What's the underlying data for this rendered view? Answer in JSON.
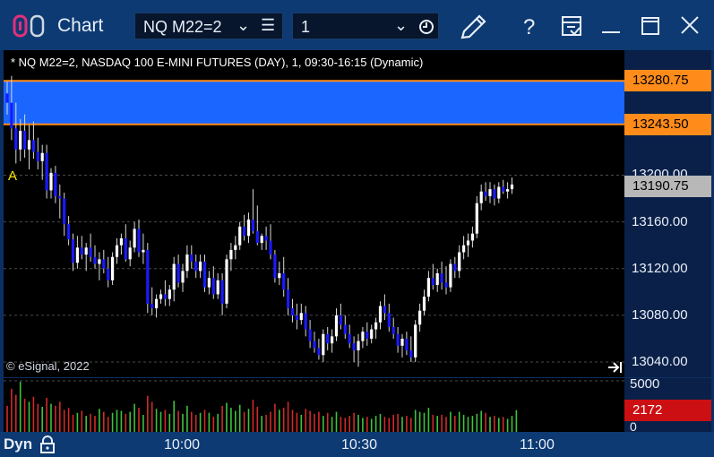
{
  "titlebar": {
    "app_title": "Chart",
    "symbol": "NQ M22=2",
    "interval": "1",
    "icons": [
      "link-icon",
      "chevron-down-icon",
      "menu-icon",
      "chevron-down-icon",
      "clock-icon",
      "pencil-icon",
      "help-icon",
      "save-layout-icon",
      "minimize-icon",
      "maximize-icon",
      "close-icon"
    ],
    "accent": "#0d3a72"
  },
  "chart": {
    "study_title": "* NQ M22=2, NASDAQ 100 E-MINI FUTURES (DAY), 1, 09:30-16:15 (Dynamic)",
    "copyright": "© eSignal, 2022",
    "annotation": "A",
    "price_ticks": [
      "13200.00",
      "13160.00",
      "13120.00",
      "13080.00",
      "13040.00"
    ],
    "price_labels": {
      "upper": "13280.75",
      "lower": "13243.50",
      "last": "13190.75"
    },
    "volume_ticks": [
      "5000",
      "0"
    ],
    "volume_last": "2172",
    "time_ticks": [
      "10:00",
      "10:30",
      "11:00"
    ],
    "bottom_label": "Dyn",
    "colors": {
      "up": "#ffffff",
      "down": "#1a1aff",
      "band": "#1a66ff",
      "level_line": "#ff8c1a",
      "vol_up": "#3ec23e",
      "vol_down": "#d12a2a"
    }
  },
  "chart_data": {
    "type": "candlestick",
    "ylim": [
      13027,
      13307
    ],
    "band": [
      13243.5,
      13280.75
    ],
    "price_ticks": [
      13200,
      13160,
      13120,
      13080,
      13040
    ],
    "last_price": 13190.75,
    "ohlc": [
      [
        13270,
        13280,
        13252,
        13262
      ],
      [
        13262,
        13285,
        13230,
        13240
      ],
      [
        13240,
        13262,
        13210,
        13222
      ],
      [
        13222,
        13248,
        13212,
        13238
      ],
      [
        13238,
        13252,
        13215,
        13222
      ],
      [
        13222,
        13243,
        13205,
        13230
      ],
      [
        13230,
        13246,
        13214,
        13220
      ],
      [
        13220,
        13232,
        13205,
        13212
      ],
      [
        13212,
        13226,
        13196,
        13219
      ],
      [
        13219,
        13226,
        13180,
        13187
      ],
      [
        13187,
        13206,
        13180,
        13202
      ],
      [
        13202,
        13208,
        13176,
        13182
      ],
      [
        13182,
        13192,
        13163,
        13180
      ],
      [
        13180,
        13185,
        13148,
        13158
      ],
      [
        13158,
        13165,
        13140,
        13145
      ],
      [
        13145,
        13150,
        13118,
        13125
      ],
      [
        13125,
        13148,
        13120,
        13138
      ],
      [
        13138,
        13148,
        13128,
        13132
      ],
      [
        13132,
        13142,
        13118,
        13138
      ],
      [
        13138,
        13150,
        13126,
        13130
      ],
      [
        13130,
        13140,
        13120,
        13124
      ],
      [
        13124,
        13134,
        13110,
        13128
      ],
      [
        13128,
        13136,
        13116,
        13120
      ],
      [
        13120,
        13130,
        13104,
        13110
      ],
      [
        13110,
        13134,
        13106,
        13130
      ],
      [
        13130,
        13146,
        13124,
        13140
      ],
      [
        13140,
        13150,
        13132,
        13146
      ],
      [
        13146,
        13158,
        13126,
        13128
      ],
      [
        13128,
        13144,
        13122,
        13138
      ],
      [
        13138,
        13160,
        13134,
        13154
      ],
      [
        13154,
        13162,
        13130,
        13134
      ],
      [
        13134,
        13150,
        13124,
        13136
      ],
      [
        13136,
        13142,
        13082,
        13090
      ],
      [
        13090,
        13104,
        13080,
        13086
      ],
      [
        13086,
        13098,
        13078,
        13094
      ],
      [
        13094,
        13102,
        13090,
        13098
      ],
      [
        13098,
        13110,
        13088,
        13094
      ],
      [
        13094,
        13106,
        13088,
        13102
      ],
      [
        13102,
        13130,
        13092,
        13124
      ],
      [
        13124,
        13132,
        13104,
        13108
      ],
      [
        13108,
        13124,
        13100,
        13118
      ],
      [
        13118,
        13140,
        13112,
        13132
      ],
      [
        13132,
        13140,
        13120,
        13126
      ],
      [
        13126,
        13132,
        13112,
        13118
      ],
      [
        13118,
        13132,
        13112,
        13126
      ],
      [
        13126,
        13132,
        13100,
        13104
      ],
      [
        13104,
        13118,
        13098,
        13112
      ],
      [
        13112,
        13122,
        13094,
        13098
      ],
      [
        13098,
        13116,
        13094,
        13110
      ],
      [
        13110,
        13116,
        13080,
        13090
      ],
      [
        13090,
        13132,
        13086,
        13128
      ],
      [
        13128,
        13142,
        13118,
        13136
      ],
      [
        13136,
        13148,
        13128,
        13140
      ],
      [
        13140,
        13160,
        13136,
        13156
      ],
      [
        13156,
        13166,
        13144,
        13148
      ],
      [
        13148,
        13168,
        13142,
        13162
      ],
      [
        13162,
        13188,
        13150,
        13152
      ],
      [
        13152,
        13174,
        13140,
        13142
      ],
      [
        13142,
        13150,
        13136,
        13148
      ],
      [
        13148,
        13156,
        13136,
        13144
      ],
      [
        13144,
        13158,
        13128,
        13132
      ],
      [
        13132,
        13136,
        13108,
        13112
      ],
      [
        13112,
        13126,
        13106,
        13116
      ],
      [
        13116,
        13130,
        13096,
        13102
      ],
      [
        13102,
        13112,
        13080,
        13086
      ],
      [
        13086,
        13094,
        13074,
        13080
      ],
      [
        13080,
        13090,
        13068,
        13076
      ],
      [
        13076,
        13090,
        13072,
        13082
      ],
      [
        13082,
        13088,
        13062,
        13068
      ],
      [
        13068,
        13076,
        13052,
        13058
      ],
      [
        13058,
        13066,
        13048,
        13052
      ],
      [
        13052,
        13060,
        13042,
        13046
      ],
      [
        13046,
        13068,
        13040,
        13064
      ],
      [
        13064,
        13070,
        13050,
        13056
      ],
      [
        13056,
        13068,
        13048,
        13062
      ],
      [
        13062,
        13086,
        13058,
        13080
      ],
      [
        13080,
        13090,
        13068,
        13072
      ],
      [
        13072,
        13080,
        13060,
        13064
      ],
      [
        13064,
        13072,
        13052,
        13056
      ],
      [
        13056,
        13062,
        13040,
        13050
      ],
      [
        13050,
        13064,
        13036,
        13058
      ],
      [
        13058,
        13070,
        13052,
        13066
      ],
      [
        13066,
        13074,
        13054,
        13060
      ],
      [
        13060,
        13072,
        13056,
        13068
      ],
      [
        13068,
        13078,
        13060,
        13074
      ],
      [
        13074,
        13092,
        13068,
        13088
      ],
      [
        13088,
        13098,
        13076,
        13082
      ],
      [
        13082,
        13090,
        13066,
        13070
      ],
      [
        13070,
        13078,
        13060,
        13064
      ],
      [
        13064,
        13070,
        13048,
        13054
      ],
      [
        13054,
        13064,
        13044,
        13060
      ],
      [
        13060,
        13066,
        13046,
        13050
      ],
      [
        13050,
        13062,
        13040,
        13044
      ],
      [
        13044,
        13076,
        13040,
        13072
      ],
      [
        13072,
        13090,
        13066,
        13084
      ],
      [
        13084,
        13102,
        13080,
        13096
      ],
      [
        13096,
        13118,
        13092,
        13112
      ],
      [
        13112,
        13124,
        13102,
        13106
      ],
      [
        13106,
        13120,
        13100,
        13116
      ],
      [
        13116,
        13126,
        13102,
        13108
      ],
      [
        13108,
        13122,
        13098,
        13104
      ],
      [
        13104,
        13128,
        13100,
        13124
      ],
      [
        13124,
        13130,
        13112,
        13118
      ],
      [
        13118,
        13140,
        13112,
        13134
      ],
      [
        13134,
        13148,
        13128,
        13140
      ],
      [
        13140,
        13150,
        13130,
        13144
      ],
      [
        13144,
        13156,
        13138,
        13150
      ],
      [
        13150,
        13182,
        13146,
        13176
      ],
      [
        13176,
        13192,
        13170,
        13186
      ],
      [
        13186,
        13194,
        13178,
        13182
      ],
      [
        13182,
        13194,
        13176,
        13188
      ],
      [
        13188,
        13192,
        13174,
        13180
      ],
      [
        13180,
        13194,
        13176,
        13190
      ],
      [
        13190,
        13196,
        13184,
        13186
      ],
      [
        13186,
        13194,
        13180,
        13188
      ],
      [
        13188,
        13198,
        13184,
        13192
      ]
    ],
    "volume": [
      2600,
      4300,
      3700,
      5000,
      3300,
      3000,
      3500,
      2800,
      2500,
      3400,
      2800,
      2600,
      3000,
      2200,
      2400,
      1700,
      1900,
      2100,
      1600,
      1800,
      1600,
      2300,
      2000,
      1500,
      1900,
      2200,
      2100,
      1800,
      2000,
      2800,
      2400,
      1700,
      3600,
      3000,
      2300,
      2000,
      2200,
      1800,
      3100,
      2100,
      1800,
      2600,
      2000,
      1700,
      1900,
      2200,
      1900,
      1500,
      1800,
      2600,
      2900,
      2400,
      2100,
      2700,
      2000,
      2300,
      3200,
      2500,
      1600,
      1700,
      2000,
      2800,
      2200,
      2400,
      3000,
      2200,
      1900,
      1700,
      2300,
      2100,
      1800,
      2000,
      1600,
      1900,
      1500,
      2000,
      1500,
      1400,
      1600,
      1900,
      1700,
      1400,
      1500,
      1300,
      1600,
      1800,
      1500,
      1400,
      1700,
      1800,
      1500,
      1600,
      1400,
      2200,
      2000,
      1900,
      2400,
      1700,
      1600,
      1700,
      1500,
      2000,
      1600,
      2000,
      1700,
      1500,
      1600,
      1800,
      2100,
      1900,
      1500,
      1600,
      1400,
      1500,
      1300,
      1600,
      2172
    ],
    "volume_ylim": [
      0,
      5000
    ],
    "time_ticks": [
      "10:00",
      "10:30",
      "11:00"
    ]
  }
}
